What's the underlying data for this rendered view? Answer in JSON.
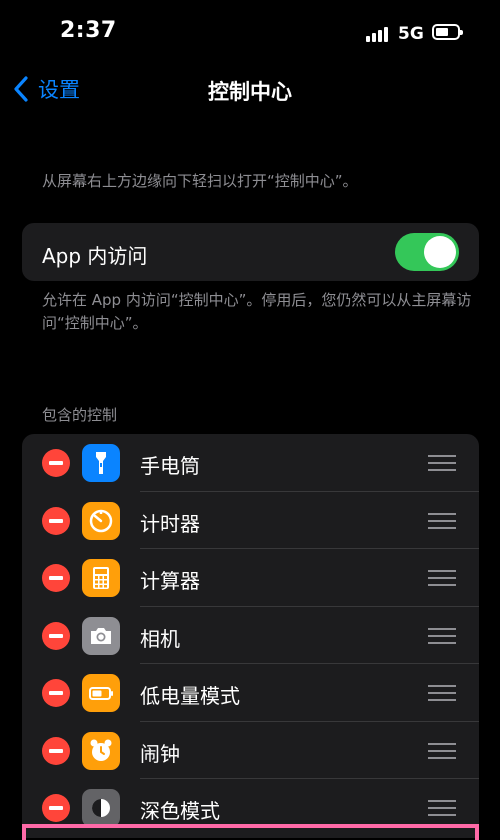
{
  "status": {
    "time": "2:37",
    "network": "5G",
    "battery_level": 0.6
  },
  "nav": {
    "back_label": "设置",
    "title": "控制中心"
  },
  "description": "从屏幕右上方边缘向下轻扫以打开“控制中心”。",
  "access": {
    "label": "App 内访问",
    "enabled": true
  },
  "access_footer": "允许在 App 内访问“控制中心”。停用后，您仍然可以从主屏幕访问“控制中心”。",
  "section_header": "包含的控制",
  "controls": [
    {
      "label": "手电筒",
      "icon": "flashlight-icon",
      "color": "#0a84ff"
    },
    {
      "label": "计时器",
      "icon": "timer-icon",
      "color": "#ff9f0a"
    },
    {
      "label": "计算器",
      "icon": "calculator-icon",
      "color": "#ff9f0a"
    },
    {
      "label": "相机",
      "icon": "camera-icon",
      "color": "#8e8e93"
    },
    {
      "label": "低电量模式",
      "icon": "battery-icon",
      "color": "#ff9f0a"
    },
    {
      "label": "闹钟",
      "icon": "alarm-clock-icon",
      "color": "#ff9f0a"
    },
    {
      "label": "深色模式",
      "icon": "dark-mode-icon",
      "color": "#636366"
    }
  ],
  "colors": {
    "accent": "#0a84ff",
    "toggle_on": "#34c759",
    "remove": "#ff453a",
    "highlight": "#ff6aa8"
  }
}
